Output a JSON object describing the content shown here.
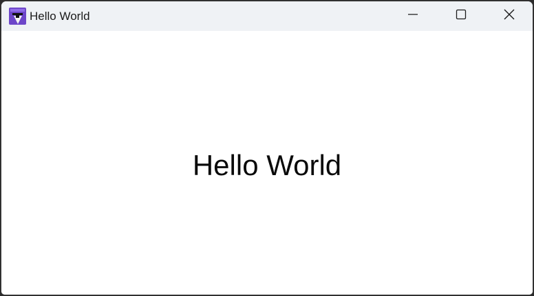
{
  "window": {
    "title": "Hello World",
    "app_icon": "app-icon",
    "controls": {
      "minimize_icon": "minimize-icon",
      "maximize_icon": "maximize-icon",
      "close_icon": "close-icon"
    }
  },
  "content": {
    "heading": "Hello World"
  },
  "colors": {
    "titlebar_bg": "#eff2f5",
    "content_bg": "#ffffff",
    "icon_accent": "#8b5cf6"
  }
}
